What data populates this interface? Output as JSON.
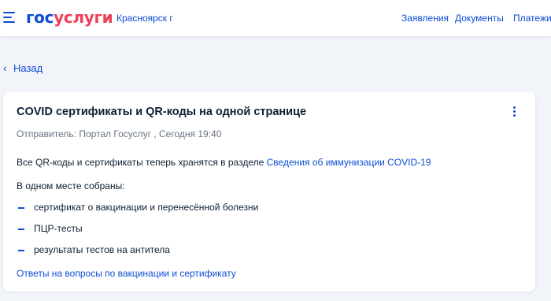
{
  "header": {
    "logo_part1": "гос",
    "logo_part2": "услуги",
    "region": "Красноярск г",
    "nav": [
      "Заявления",
      "Документы",
      "Платежи"
    ]
  },
  "back_label": "Назад",
  "message": {
    "title": "COVID сертификаты и QR-коды на одной странице",
    "sender": "Отправитель: Портал Госуслуг , Сегодня 19:40",
    "intro_text": "Все QR-коды и сертификаты теперь хранятся в разделе ",
    "intro_link": "Сведения об иммунизации COVID-19",
    "list_heading": "В одном месте собраны:",
    "bullets": [
      "сертификат о вакцинации и перенесённой болезни",
      "ПЦР-тесты",
      "результаты тестов на антитела"
    ],
    "faq_link": "Ответы на вопросы по вакцинации и сертификату"
  },
  "colors": {
    "brand_blue": "#0d4cd3",
    "brand_red": "#ee3f58",
    "background": "#f1f4f9",
    "text": "#0b1f33",
    "muted": "#66727f"
  },
  "icons": {
    "menu": "hamburger-icon",
    "back": "chevron-left-icon",
    "more": "kebab-menu-icon"
  }
}
